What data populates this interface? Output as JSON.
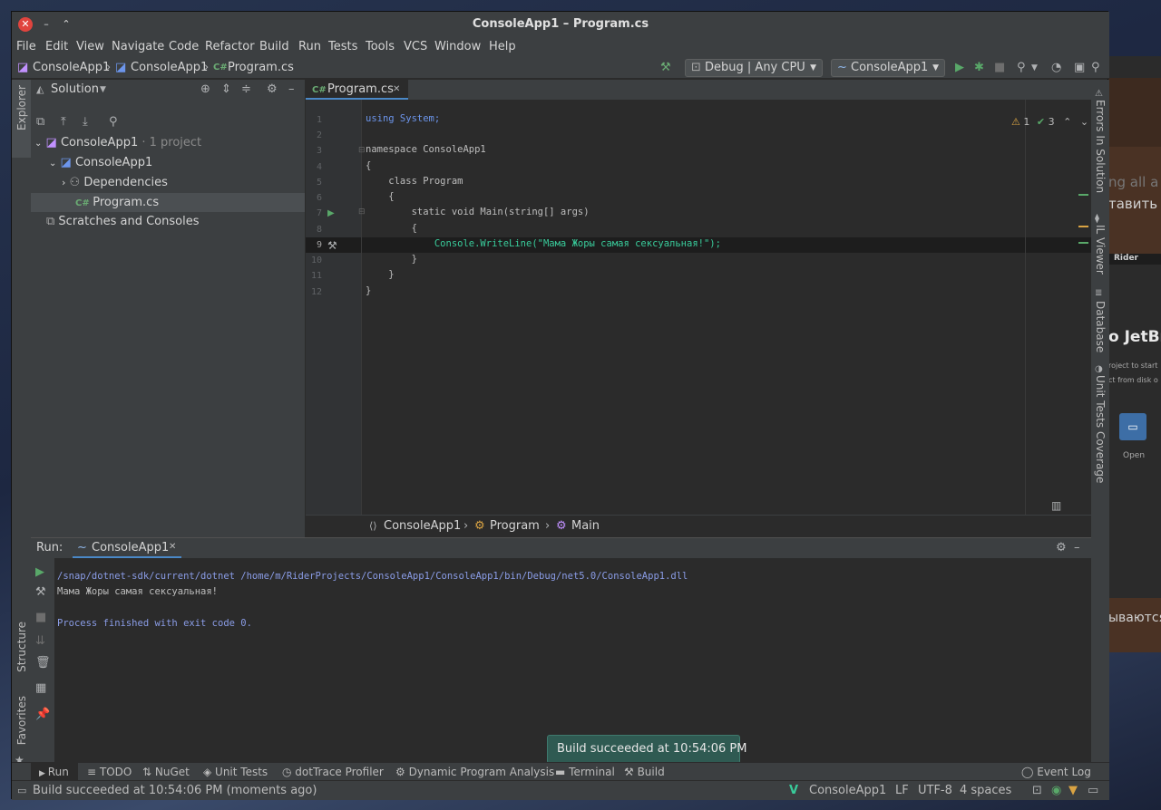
{
  "window": {
    "title": "ConsoleApp1 – Program.cs"
  },
  "menu": [
    "File",
    "Edit",
    "View",
    "Navigate",
    "Code",
    "Refactor",
    "Build",
    "Run",
    "Tests",
    "Tools",
    "VCS",
    "Window",
    "Help"
  ],
  "nav": {
    "crumb1": "ConsoleApp1",
    "crumb2": "ConsoleApp1",
    "crumb3": "Program.cs",
    "config": "Debug | Any CPU",
    "run_config": "ConsoleApp1"
  },
  "left_tabs": {
    "explorer": "Explorer",
    "structure": "Structure",
    "favorites": "Favorites"
  },
  "solution": {
    "header": "Solution",
    "root": "ConsoleApp1",
    "root_note": " · 1 project",
    "project": "ConsoleApp1",
    "dependencies": "Dependencies",
    "file": "Program.cs",
    "scratches": "Scratches and Consoles"
  },
  "editor": {
    "tab": "Program.cs",
    "warnings": "1",
    "checks": "3",
    "line_numbers": [
      "1",
      "2",
      "3",
      "4",
      "5",
      "6",
      "7",
      "8",
      "9",
      "10",
      "11",
      "12"
    ],
    "lines": [
      "using System;",
      "",
      "namespace ConsoleApp1",
      "{",
      "    class Program",
      "    {",
      "        static void Main(string[] args)",
      "        {",
      "            Console.WriteLine(\"Мама Жоры самая сексуальная!\");",
      "        }",
      "    }",
      "}"
    ],
    "breadcrumb": [
      "ConsoleApp1",
      "Program",
      "Main"
    ]
  },
  "right_tabs": {
    "errors": "Errors In Solution",
    "il": "IL Viewer",
    "db": "Database",
    "coverage": "Unit Tests Coverage"
  },
  "run": {
    "label": "Run:",
    "tab": "ConsoleApp1",
    "output": [
      "/snap/dotnet-sdk/current/dotnet /home/m/RiderProjects/ConsoleApp1/ConsoleApp1/bin/Debug/net5.0/ConsoleApp1.dll",
      "Мама Жоры самая сексуальная!",
      "",
      "Process finished with exit code 0."
    ]
  },
  "bottom_tools": {
    "run": "Run",
    "todo": "TODO",
    "nuget": "NuGet",
    "unit_tests": "Unit Tests",
    "dottrace": "dotTrace Profiler",
    "dpa": "Dynamic Program Analysis",
    "terminal": "Terminal",
    "build": "Build",
    "event_log": "Event Log"
  },
  "toast": "Build succeeded at 10:54:06 PM",
  "status": {
    "message": "Build succeeded at 10:54:06 PM (moments ago)",
    "project": "ConsoleApp1",
    "line_sep": "LF",
    "encoding": "UTF-8",
    "indent": "4 spaces"
  },
  "background_app": {
    "t1": "ng all a",
    "t2": "тавить с",
    "t3": "Rider",
    "t4": "o JetBr",
    "t5": "roject to start",
    "t6": "ct from disk o",
    "t7": "Open",
    "t8": "ываются"
  }
}
